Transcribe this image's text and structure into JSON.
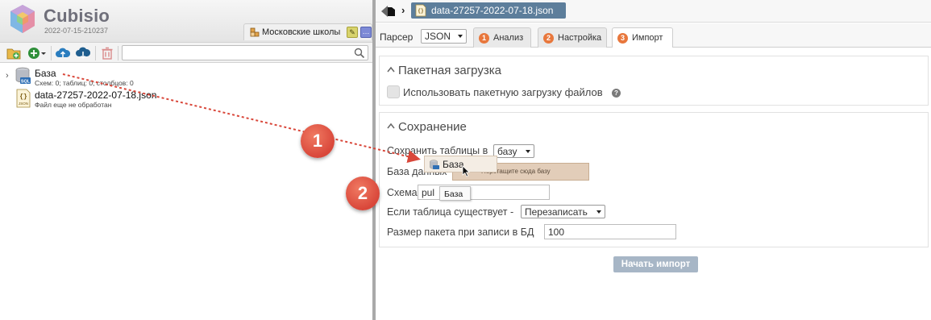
{
  "app": {
    "title": "Cubisio",
    "version": "2022-07-15-210237",
    "project_tab": "Московские школы",
    "edit_glyph": "✎",
    "more_glyph": "…"
  },
  "toolbar": {
    "icons": [
      "folder-add-icon",
      "plus-circle-icon",
      "upload-cloud-icon",
      "download-cloud-icon",
      "trash-icon"
    ],
    "search_value": ""
  },
  "tree": {
    "items": [
      {
        "name": "База",
        "sub": "Схем: 0; таблиц: 0; столбцов: 0",
        "icon": "database-icon",
        "icon_text": "SQL",
        "chevron": "›"
      },
      {
        "name": "data-27257-2022-07-18.json",
        "sub": "Файл еще не обработан",
        "icon": "json-file-icon",
        "icon_text": "JSON"
      }
    ]
  },
  "breadcrumb": {
    "separator": "›",
    "file": "data-27257-2022-07-18.json"
  },
  "parser": {
    "label": "Парсер",
    "value": "JSON"
  },
  "tabs": [
    {
      "num": "1",
      "label": "Анализ",
      "active": false
    },
    {
      "num": "2",
      "label": "Настройка",
      "active": false
    },
    {
      "num": "3",
      "label": "Импорт",
      "active": true
    }
  ],
  "batch": {
    "title": "Пакетная загрузка",
    "checkbox_label": "Использовать пакетную загрузку файлов",
    "checked": false,
    "help": "?"
  },
  "save": {
    "title": "Сохранение",
    "save_tables_label": "Сохранить таблицы в",
    "save_tables_value": "базу",
    "database_label": "База данных",
    "drop_hint": "Перетащите сюда базу",
    "drag_ghost": "База",
    "schema_label": "Схема",
    "schema_value": "pul",
    "schema_tooltip": "База",
    "if_exists_label": "Если таблица существует -",
    "if_exists_value": "Перезаписать",
    "batch_size_label": "Размер пакета при записи в БД",
    "batch_size_value": "100"
  },
  "actions": {
    "start_import": "Начать импорт"
  },
  "callouts": [
    "1",
    "2"
  ],
  "colors": {
    "accent_tab_number": "#e8773c",
    "breadcrumb_bg": "#5d7e9b",
    "callout": "#d9473a",
    "button_disabled": "#a7b6c6",
    "drop_zone": "#e2cdb9"
  }
}
